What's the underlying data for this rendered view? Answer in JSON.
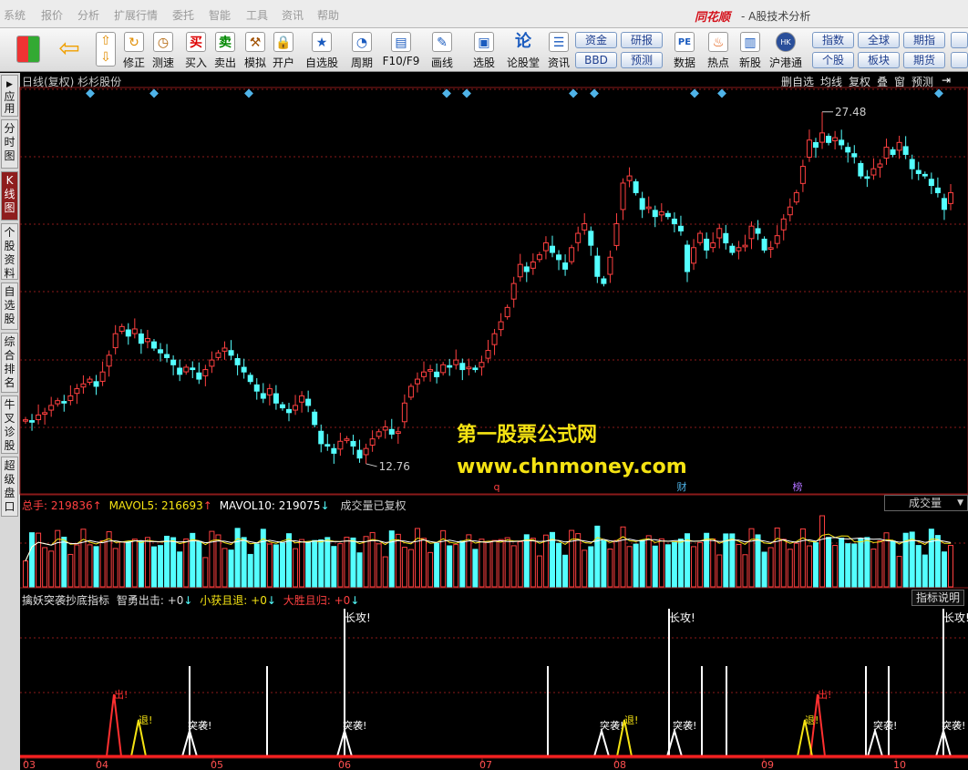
{
  "menu": [
    "系统",
    "报价",
    "分析",
    "扩展行情",
    "委托",
    "智能",
    "工具",
    "资讯",
    "帮助"
  ],
  "brand": {
    "name": "同花顺",
    "subtitle": "- A股技术分析"
  },
  "toolbar": {
    "buttons": [
      "修正",
      "测速",
      "买入",
      "卖出",
      "模拟",
      "开户",
      "自选股",
      "周期",
      "F10/F9",
      "画线",
      "选股",
      "论股堂",
      "资讯",
      "数据",
      "热点",
      "新股",
      "沪港通"
    ],
    "small_buttons": [
      "资金",
      "BBD",
      "研报",
      "预测",
      "指数",
      "个股",
      "全球",
      "板块",
      "期指",
      "期货"
    ]
  },
  "sidebar_tabs": [
    "应用",
    "分时图",
    "K线图",
    "个股资料",
    "自选股",
    "综合排名",
    "牛叉诊股",
    "超级盘口"
  ],
  "chart": {
    "title": "日线(复权)  杉杉股份",
    "right_buttons": [
      "删自选",
      "均线",
      "复权",
      "叠",
      "窗",
      "预测"
    ],
    "high_label": "27.48",
    "low_label": "12.76",
    "event_markers": [
      "q",
      "财",
      "榜"
    ]
  },
  "volume": {
    "total_label": "总手: 219836",
    "ma5_label": "MAVOL5: 216693",
    "ma10_label": "MAVOL10: 219075",
    "note": "成交量已复权",
    "select_value": "成交量"
  },
  "indicator": {
    "name": "擒妖突袭抄底指标",
    "items": [
      "智勇出击: +0",
      "小获且退: +0",
      "大胜且归: +0"
    ],
    "help_label": "指标说明",
    "signal_labels": [
      "长攻!",
      "突袭!",
      "出!",
      "退!"
    ]
  },
  "watermark": {
    "line1": "第一股票公式网",
    "line2": "www.chnmoney.com"
  },
  "x_axis_labels": [
    "03",
    "04",
    "05",
    "06",
    "07",
    "08",
    "09",
    "10"
  ],
  "colors": {
    "up": "#ff4040",
    "down": "#54ffff",
    "grid": "#8b1a1a",
    "yellow": "#f5e313",
    "marker": "#4fb3e8"
  },
  "chart_data": {
    "type": "candlestick",
    "title": "日线(复权)  杉杉股份",
    "high": 27.48,
    "low": 12.76,
    "ylim": [
      11.5,
      28.5
    ],
    "x_labels": [
      "03",
      "04",
      "05",
      "06",
      "07",
      "08",
      "09",
      "10"
    ],
    "close": [
      14.6,
      14.5,
      14.8,
      14.9,
      15.2,
      15.4,
      15.3,
      15.6,
      15.9,
      16.1,
      16.3,
      16.0,
      16.6,
      17.3,
      18.2,
      18.5,
      18.1,
      18.4,
      17.8,
      18.0,
      17.6,
      17.4,
      17.2,
      16.9,
      16.5,
      16.8,
      16.7,
      16.3,
      16.7,
      17.1,
      17.4,
      17.6,
      17.3,
      16.9,
      16.6,
      16.2,
      15.8,
      15.5,
      15.9,
      15.3,
      15.1,
      14.9,
      15.2,
      15.6,
      15.2,
      14.4,
      13.6,
      13.5,
      13.2,
      13.7,
      13.8,
      13.5,
      13.0,
      13.4,
      13.8,
      14.1,
      14.3,
      14.0,
      14.1,
      15.3,
      16.0,
      16.3,
      16.6,
      16.7,
      16.4,
      16.9,
      16.8,
      17.1,
      16.7,
      16.8,
      16.7,
      17.0,
      17.5,
      18.2,
      18.7,
      19.3,
      20.3,
      21.1,
      20.8,
      21.2,
      21.5,
      22.0,
      21.6,
      21.3,
      20.9,
      21.8,
      22.4,
      22.8,
      21.9,
      20.6,
      20.3,
      21.4,
      22.8,
      24.5,
      24.8,
      24.1,
      23.4,
      23.5,
      23.1,
      23.3,
      23.1,
      22.8,
      22.5,
      20.8,
      21.8,
      22.4,
      21.7,
      22.0,
      22.6,
      22.0,
      21.6,
      21.8,
      21.9,
      22.7,
      22.4,
      21.7,
      21.8,
      22.3,
      23.0,
      23.5,
      24.1,
      25.2,
      26.3,
      26.0,
      26.6,
      26.2,
      26.4,
      26.1,
      25.8,
      25.6,
      24.8,
      24.7,
      25.1,
      25.3,
      26.0,
      25.7,
      26.2,
      25.7,
      25.1,
      24.9,
      24.8,
      24.4,
      24.1,
      23.4,
      24.1
    ]
  }
}
